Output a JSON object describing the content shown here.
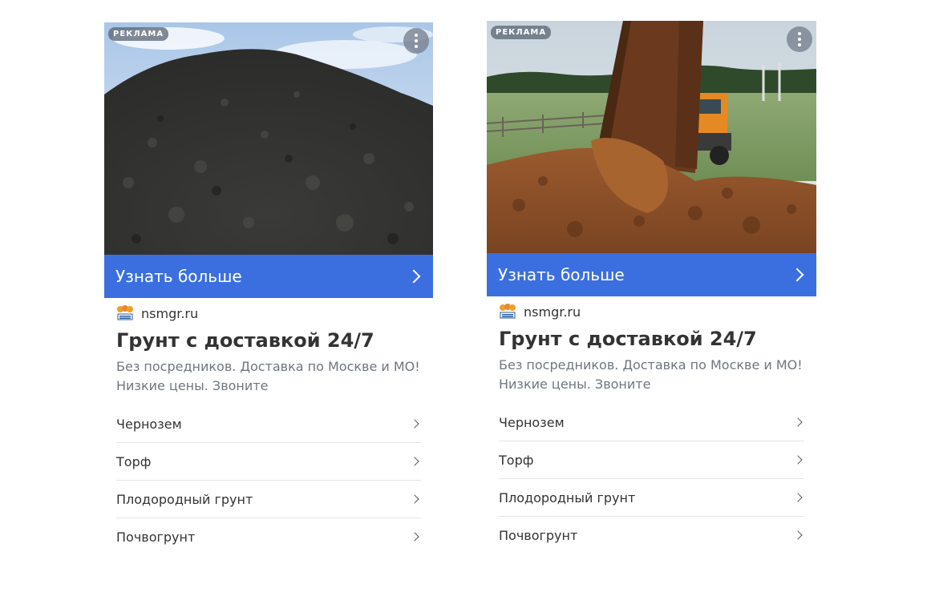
{
  "cards": [
    {
      "ad_badge": "РЕКЛАМА",
      "cta_label": "Узнать больше",
      "domain": "nsmgr.ru",
      "title": "Грунт с доставкой 24/7",
      "description": "Без посредников. Доставка по Москве и МО! Низкие цены. Звоните",
      "links": [
        "Чернозем",
        "Торф",
        "Плодородный грунт",
        "Почвогрунт"
      ],
      "image": "soil-pile-photo"
    },
    {
      "ad_badge": "РЕКЛАМА",
      "cta_label": "Узнать больше",
      "domain": "nsmgr.ru",
      "title": "Грунт с доставкой 24/7",
      "description": "Без посредников. Доставка по Москве и МО! Низкие цены. Звоните",
      "links": [
        "Чернозем",
        "Торф",
        "Плодородный грунт",
        "Почвогрунт"
      ],
      "image": "dump-truck-photo"
    }
  ],
  "colors": {
    "cta": "#3b6fe0",
    "title": "#333333",
    "description": "#6f7680",
    "divider": "#e4e4e4"
  }
}
